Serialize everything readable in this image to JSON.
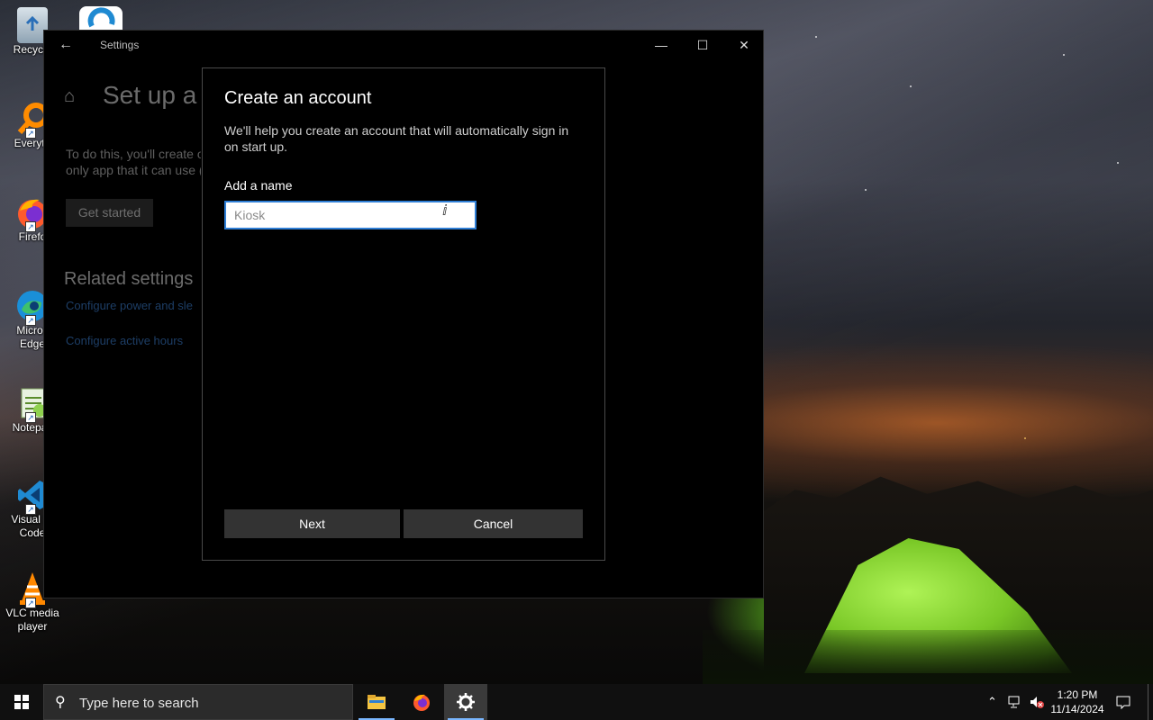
{
  "desktop": {
    "icons": [
      {
        "label": "Recycle",
        "icon": "recycle-bin-icon"
      },
      {
        "label": "Everyth",
        "icon": "everything-search-icon"
      },
      {
        "label": "Firefo",
        "icon": "firefox-icon"
      },
      {
        "label": "Micros\nEdge",
        "icon": "edge-icon"
      },
      {
        "label": "Notepac",
        "icon": "notepad-plus-plus-icon"
      },
      {
        "label": "Visual St\nCode",
        "icon": "vscode-icon"
      },
      {
        "label": "VLC media\nplayer",
        "icon": "vlc-icon"
      }
    ]
  },
  "settings": {
    "window_title": "Settings",
    "page_title": "Set up a k",
    "description_lines": [
      "To do this, you'll create o",
      "only app that it can use ("
    ],
    "get_started_label": "Get started",
    "related_heading": "Related settings",
    "links": [
      "Configure power and sle",
      "Configure active hours"
    ]
  },
  "dialog": {
    "title": "Create an account",
    "description": "We'll help you create an account that will automatically sign in on start up.",
    "name_label": "Add a name",
    "name_placeholder": "Kiosk",
    "name_value": "",
    "next_label": "Next",
    "cancel_label": "Cancel"
  },
  "taskbar": {
    "search_placeholder": "Type here to search",
    "apps": [
      "file-explorer-icon",
      "firefox-icon",
      "settings-gear-icon"
    ],
    "active_app": "settings-gear-icon",
    "time": "1:20 PM",
    "date": "11/14/2024"
  },
  "colors": {
    "accent": "#2f7fd6",
    "dialog_button": "#333333",
    "link_dim": "#1d3e66"
  }
}
